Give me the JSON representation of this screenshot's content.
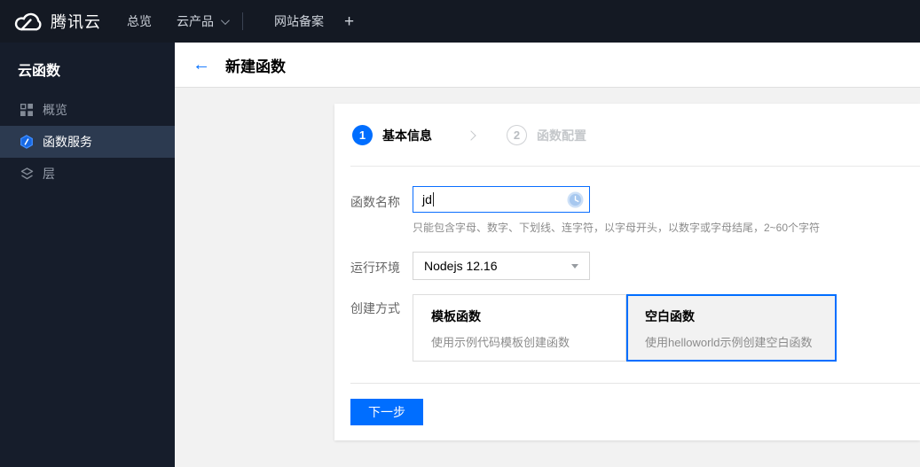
{
  "colors": {
    "accent": "#006eff",
    "topbar_bg": "#141923",
    "sidebar_bg": "#161d2b",
    "sidebar_selected_bg": "#2c3a50",
    "content_bg": "#f2f2f2",
    "step_inactive": "#c5c8cb",
    "hint_text": "#8c8c8c"
  },
  "topbar": {
    "brand": "腾讯云",
    "overview": "总览",
    "products": "云产品",
    "beian": "网站备案",
    "add": "+"
  },
  "sidebar": {
    "title": "云函数",
    "items": [
      {
        "label": "概览",
        "icon": "grid-icon",
        "selected": false
      },
      {
        "label": "函数服务",
        "icon": "hexagon-function-icon",
        "selected": true
      },
      {
        "label": "层",
        "icon": "layers-icon",
        "selected": false
      }
    ]
  },
  "header": {
    "back": "←",
    "title": "新建函数"
  },
  "stepper": {
    "steps": [
      {
        "num": "1",
        "label": "基本信息",
        "active": true
      },
      {
        "num": "2",
        "label": "函数配置",
        "active": false
      }
    ]
  },
  "form": {
    "name_label": "函数名称",
    "name_value": "jd",
    "name_hint": "只能包含字母、数字、下划线、连字符，以字母开头，以数字或字母结尾，2~60个字符",
    "runtime_label": "运行环境",
    "runtime_value": "Nodejs 12.16",
    "method_label": "创建方式",
    "method_options": [
      {
        "title": "模板函数",
        "desc": "使用示例代码模板创建函数",
        "selected": false
      },
      {
        "title": "空白函数",
        "desc": "使用helloworld示例创建空白函数",
        "selected": true
      }
    ],
    "next": "下一步"
  }
}
